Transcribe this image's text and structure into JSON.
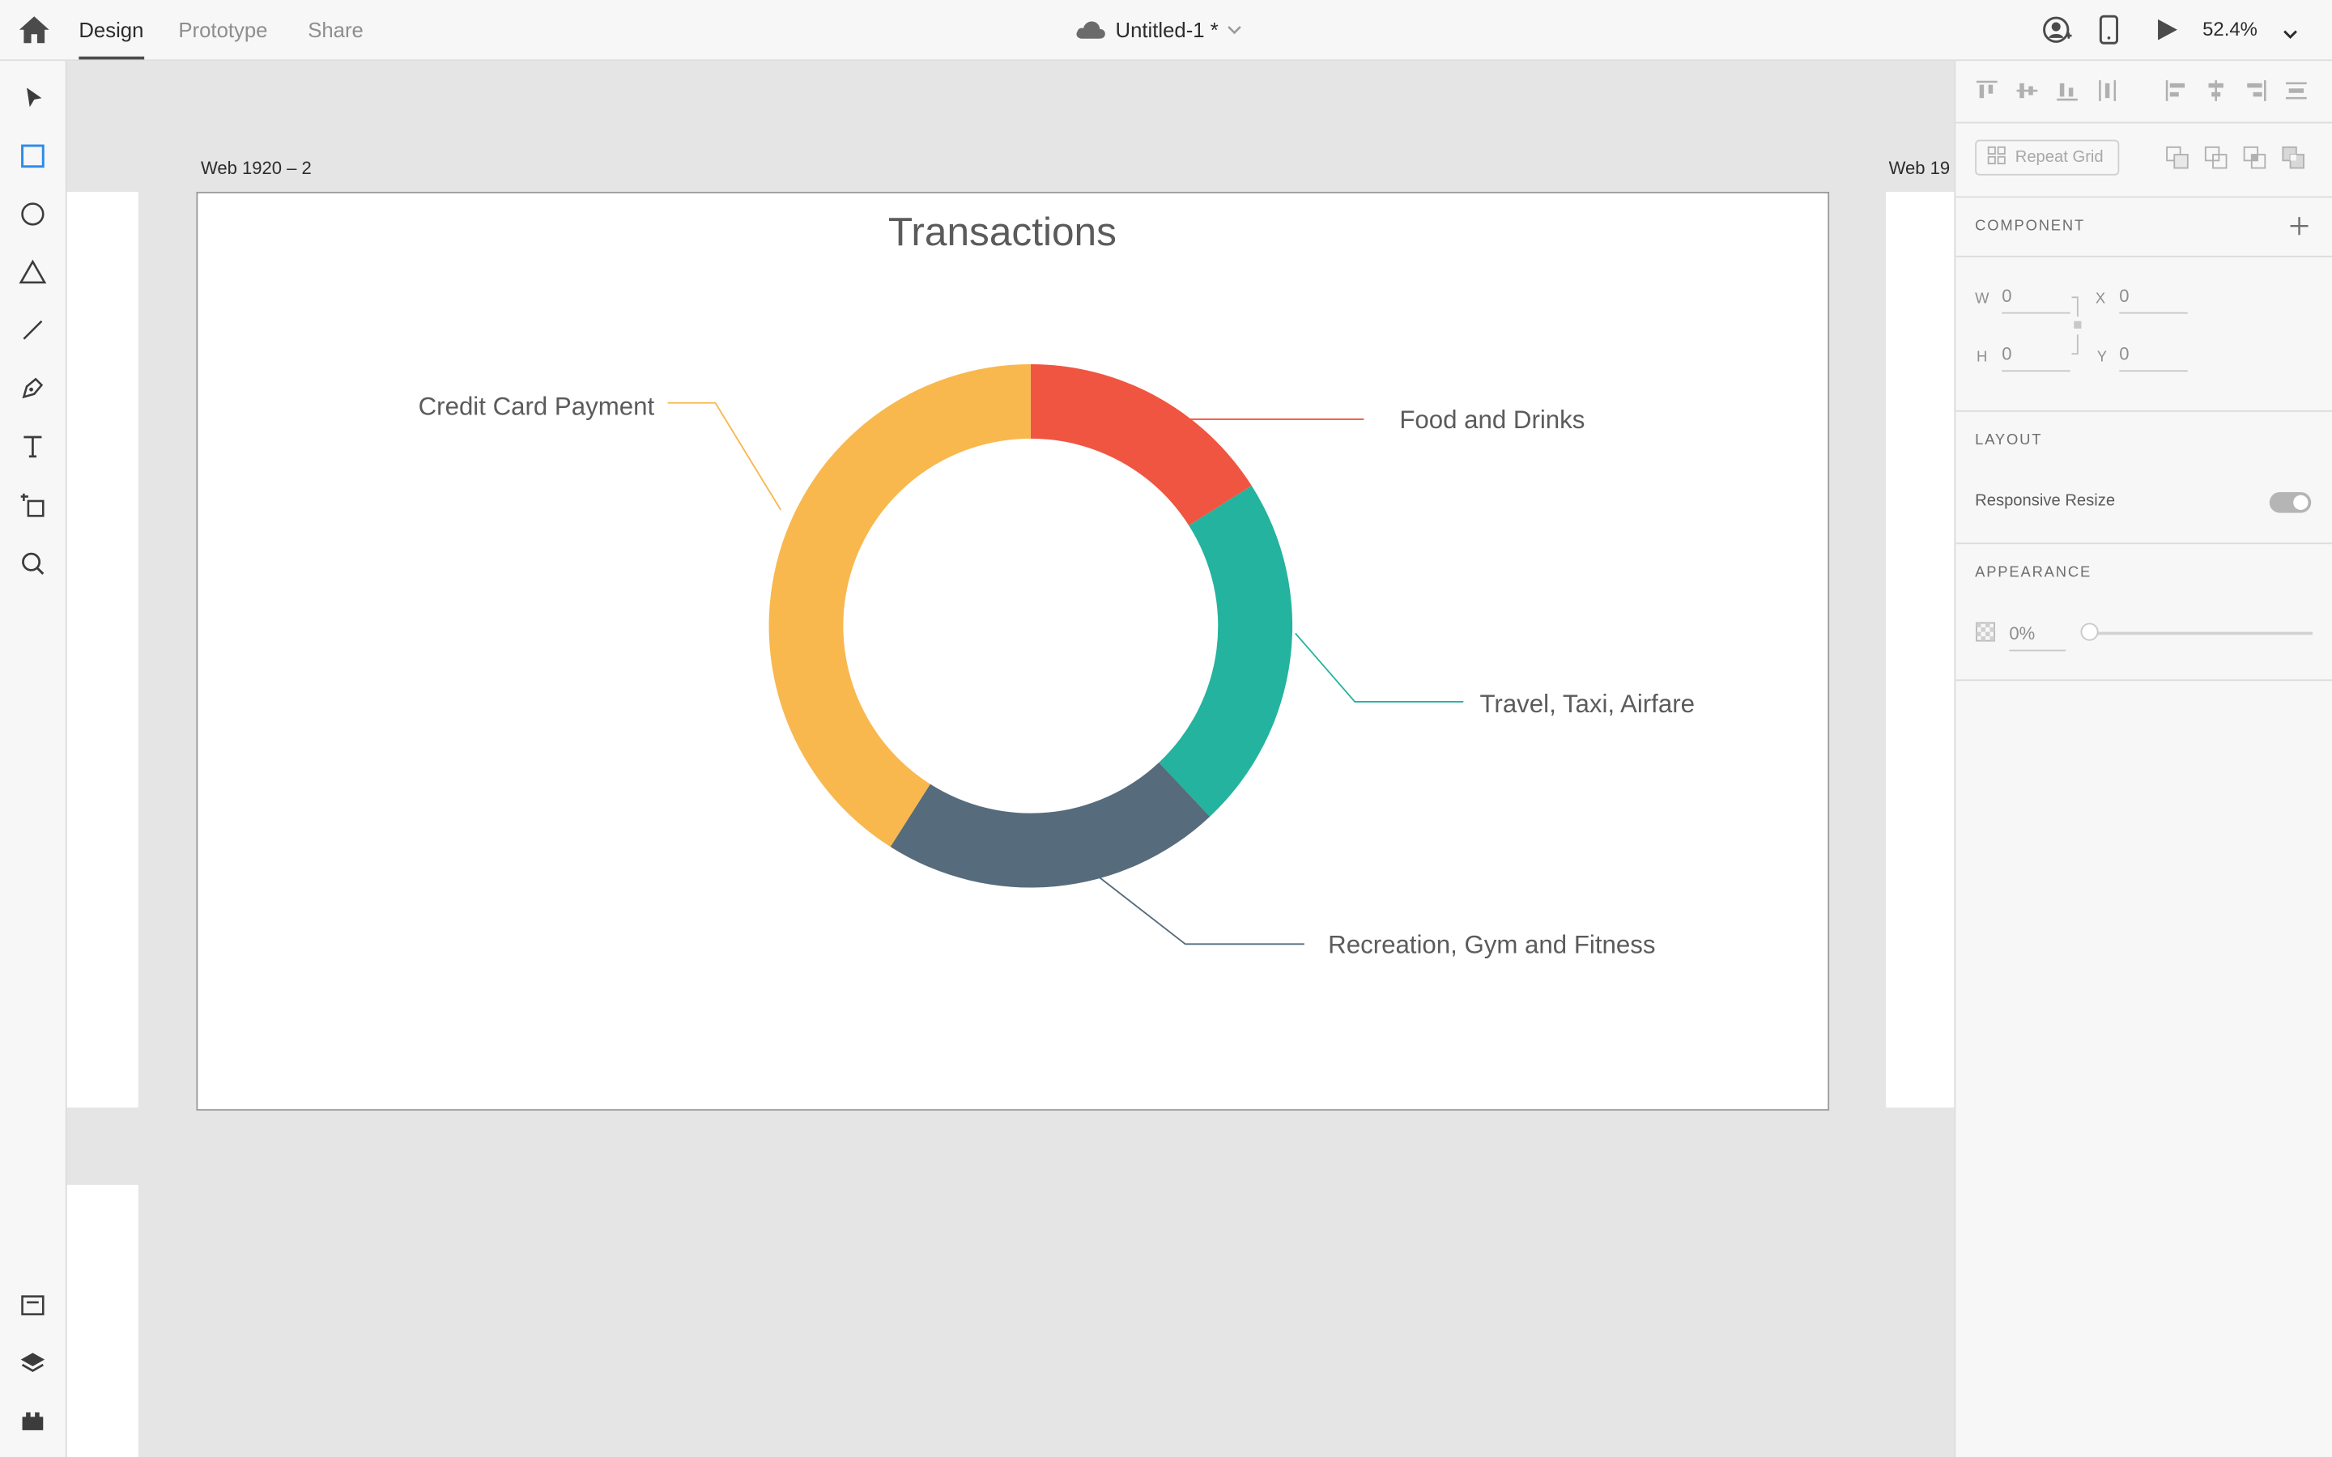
{
  "header": {
    "tabs": [
      {
        "label": "Design",
        "active": true
      },
      {
        "label": "Prototype",
        "active": false
      },
      {
        "label": "Share",
        "active": false
      }
    ],
    "document_title": "Untitled-1 *",
    "zoom": "52.4%",
    "icons": [
      "home-icon",
      "cloud-icon",
      "chevron-down-icon",
      "user-icon",
      "mobile-preview-icon",
      "play-icon"
    ]
  },
  "toolbar": {
    "tools": [
      "select-tool-icon",
      "rectangle-tool-icon",
      "ellipse-tool-icon",
      "polygon-tool-icon",
      "line-tool-icon",
      "pen-tool-icon",
      "text-tool-icon",
      "artboard-tool-icon",
      "zoom-tool-icon"
    ],
    "bottom": [
      "assets-icon",
      "layers-icon",
      "plugins-icon"
    ]
  },
  "canvas": {
    "artboards": [
      {
        "label": "Web 1920 – 2"
      },
      {
        "label": "Web 19"
      }
    ]
  },
  "chart_data": {
    "type": "pie",
    "donut": true,
    "title": "Transactions",
    "slices": [
      {
        "label": "Food and Drinks",
        "value": 16,
        "color": "#f05542"
      },
      {
        "label": "Travel, Taxi, Airfare",
        "value": 22,
        "color": "#24b39e"
      },
      {
        "label": "Recreation, Gym and Fitness",
        "value": 21,
        "color": "#566b7c"
      },
      {
        "label": "Credit Card Payment",
        "value": 41,
        "color": "#f8b84e"
      }
    ]
  },
  "panel": {
    "repeat_grid_label": "Repeat Grid",
    "component_title": "COMPONENT",
    "fields": {
      "w_label": "W",
      "w_value": "0",
      "x_label": "X",
      "x_value": "0",
      "h_label": "H",
      "h_value": "0",
      "y_label": "Y",
      "y_value": "0"
    },
    "layout_title": "LAYOUT",
    "responsive_resize_label": "Responsive Resize",
    "responsive_resize_on": true,
    "appearance_title": "APPEARANCE",
    "opacity_value": "0%"
  }
}
